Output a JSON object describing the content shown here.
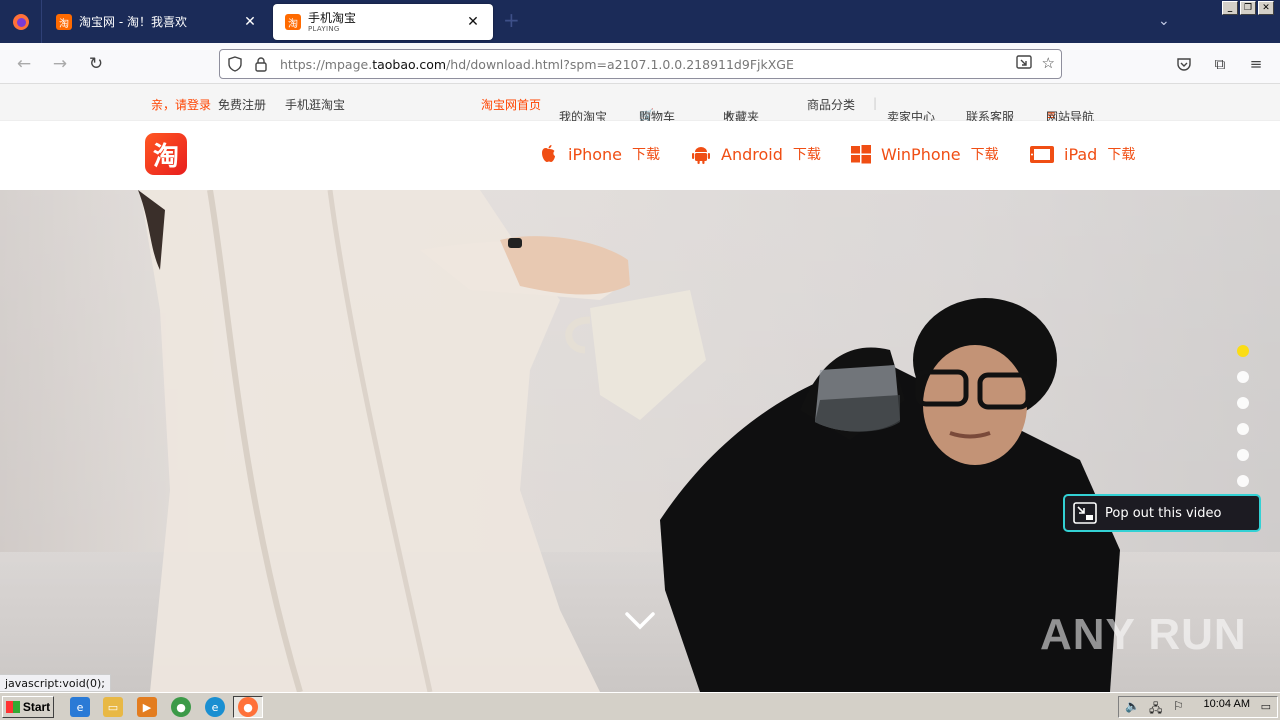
{
  "browser": {
    "tabs": [
      {
        "title": "淘宝网 - 淘！我喜欢",
        "favicon_text": "淘",
        "active": false
      },
      {
        "title": "手机淘宝",
        "subtitle": "PLAYING",
        "favicon_text": "淘",
        "active": true
      }
    ],
    "url_prefix": "https://mpage.",
    "url_domain": "taobao.com",
    "url_path": "/hd/download.html?spm=a2107.1.0.0.218911d9FjkXGE",
    "status_text": "javascript:void(0);"
  },
  "topnav": {
    "login": "亲，请登录",
    "register": "免费注册",
    "mobile": "手机逛淘宝",
    "home": "淘宝网首页",
    "my_taobao": "我的淘宝",
    "cart": "购物车",
    "favorites": "收藏夹",
    "categories": "商品分类",
    "seller": "卖家中心",
    "service": "联系客服",
    "sitemap": "网站导航"
  },
  "header": {
    "logo_char": "淘",
    "downloads": [
      {
        "platform": "iPhone",
        "suffix": "下载",
        "icon": "apple-icon"
      },
      {
        "platform": "Android",
        "suffix": "下载",
        "icon": "android-icon"
      },
      {
        "platform": "WinPhone",
        "suffix": "下载",
        "icon": "windows-icon"
      },
      {
        "platform": "iPad",
        "suffix": "下载",
        "icon": "ipad-icon"
      }
    ]
  },
  "hero": {
    "popout_label": "Pop out this video",
    "watermark": "ANY RUN",
    "active_slide": 1,
    "slide_count": 6
  },
  "taskbar": {
    "start_label": "Start",
    "clock": "10:04 AM"
  },
  "colors": {
    "brand_orange": "#f04e14",
    "tab_strip": "#1b2b58",
    "active_dot": "#ffde00",
    "popout_border": "#33d1d4"
  }
}
